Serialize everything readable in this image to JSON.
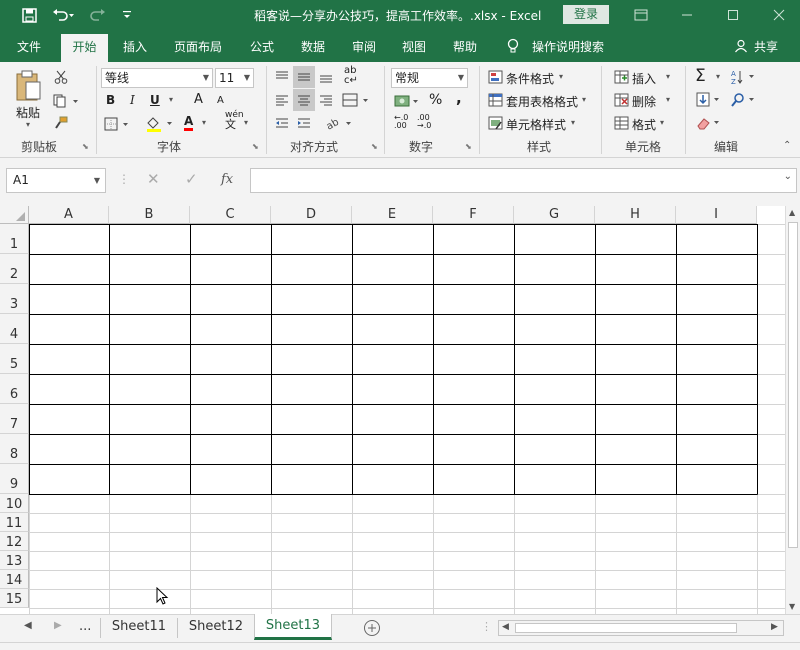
{
  "titlebar": {
    "title": "稻客说—分享办公技巧，提高工作效率。.xlsx  -  Excel",
    "login": "登录",
    "save_icon": "save-icon",
    "undo_icon": "undo-icon",
    "redo_icon": "redo-icon",
    "customize_icon": "customize-qat-icon"
  },
  "tabs": [
    "文件",
    "开始",
    "插入",
    "页面布局",
    "公式",
    "数据",
    "审阅",
    "视图",
    "帮助"
  ],
  "tell_me": "操作说明搜索",
  "share": "共享",
  "ribbon": {
    "clipboard": {
      "label": "剪贴板",
      "paste": "粘贴"
    },
    "font": {
      "label": "字体",
      "font_name": "等线",
      "font_size": "11",
      "bold": "B",
      "italic": "I",
      "underline": "U",
      "grow": "A",
      "shrink": "A",
      "wen": "wén",
      "font_color": "A"
    },
    "alignment": {
      "label": "对齐方式",
      "wrap": "ab"
    },
    "number": {
      "label": "数字",
      "format": "常规",
      "percent": "%",
      "comma": ","
    },
    "styles": {
      "label": "样式",
      "conditional": "条件格式",
      "table": "套用表格格式",
      "cell": "单元格样式"
    },
    "cells": {
      "label": "单元格",
      "insert": "插入",
      "delete": "删除",
      "format": "格式"
    },
    "editing": {
      "label": "编辑"
    }
  },
  "formula_bar": {
    "name_box": "A1",
    "fx": "fx",
    "value": ""
  },
  "columns": [
    "A",
    "B",
    "C",
    "D",
    "E",
    "F",
    "G",
    "H",
    "I"
  ],
  "rows": [
    "1",
    "2",
    "3",
    "4",
    "5",
    "6",
    "7",
    "8",
    "9",
    "10",
    "11",
    "12",
    "13",
    "14",
    "15"
  ],
  "sheets": {
    "ellipsis": "...",
    "tabs": [
      "Sheet11",
      "Sheet12",
      "Sheet13"
    ],
    "active": "Sheet13"
  },
  "colors": {
    "brand": "#217346",
    "ribbon_bg": "#f3f3f3",
    "grid_line": "#d4d4d4",
    "border": "#000000"
  }
}
